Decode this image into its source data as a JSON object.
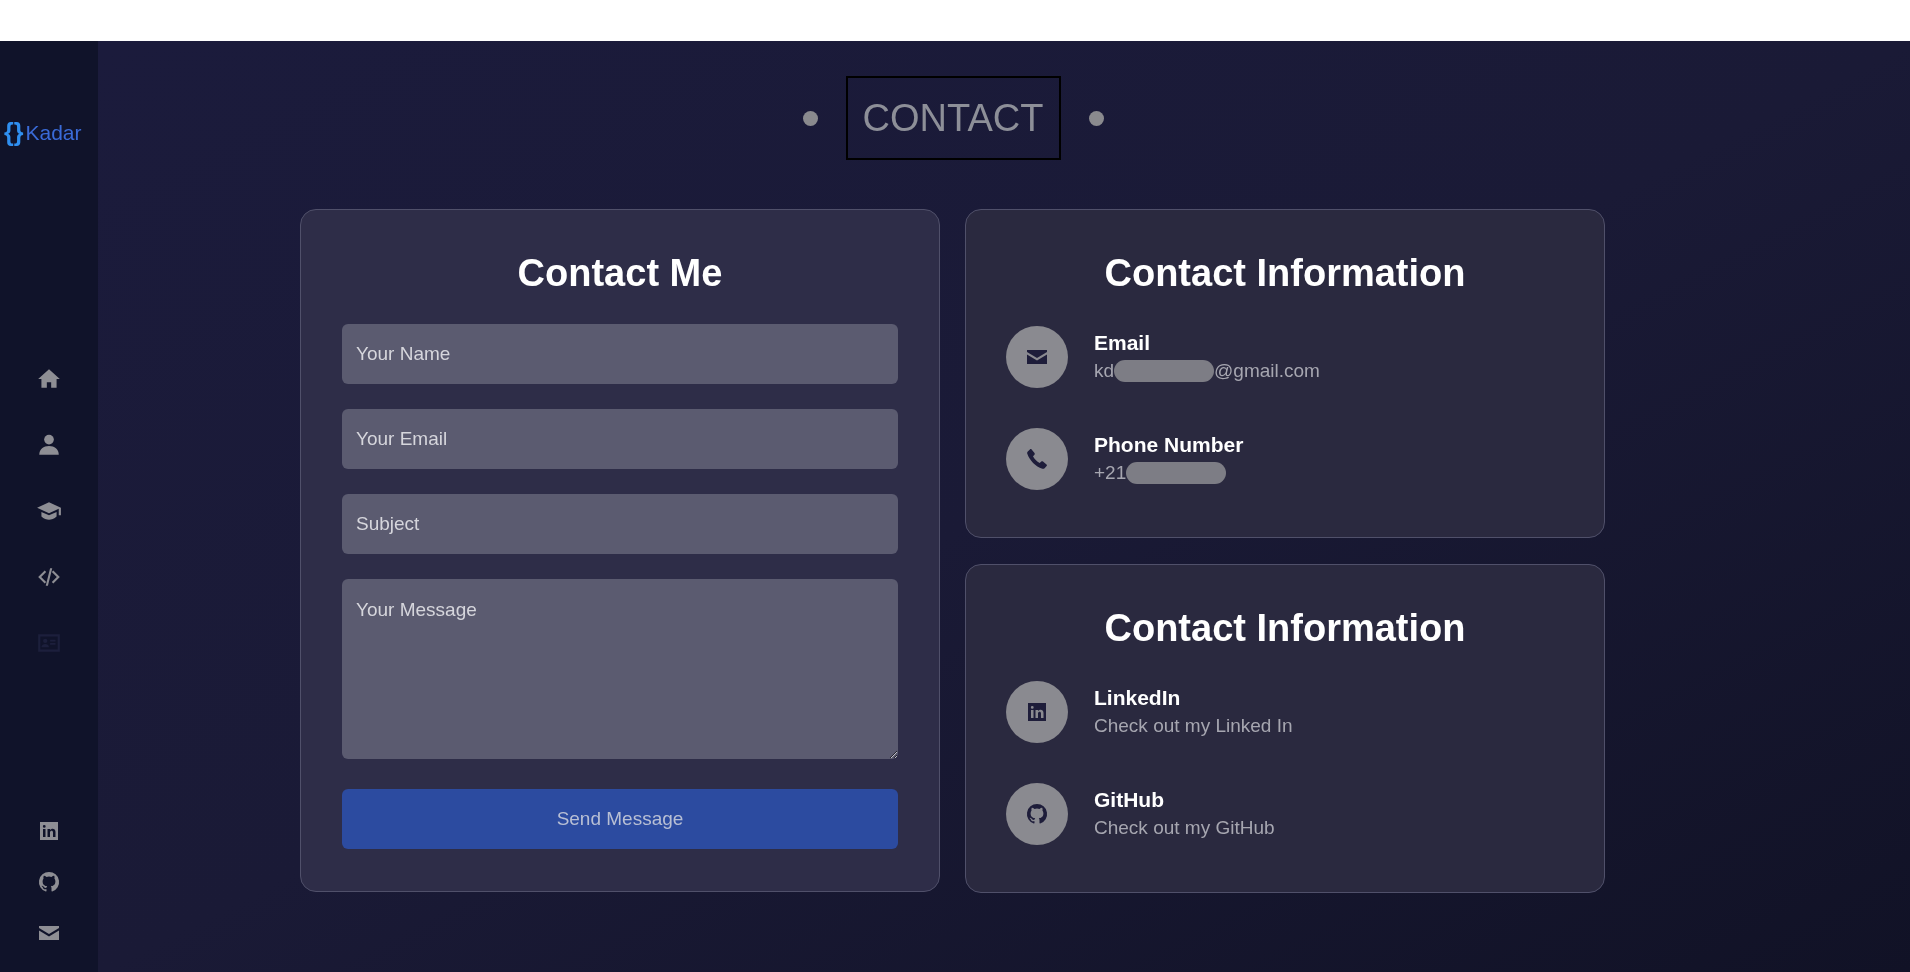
{
  "sidebar": {
    "logo": {
      "brace": "{}",
      "name": "Kadar"
    },
    "nav_items": [
      {
        "kind": "home",
        "selected": false
      },
      {
        "kind": "user",
        "selected": false
      },
      {
        "kind": "education",
        "selected": false
      },
      {
        "kind": "code",
        "selected": false
      },
      {
        "kind": "contact",
        "selected": true
      }
    ],
    "social_links": [
      {
        "kind": "linkedin"
      },
      {
        "kind": "github"
      },
      {
        "kind": "email"
      }
    ]
  },
  "section_title": "CONTACT",
  "form": {
    "title": "Contact Me",
    "fields": [
      {
        "kind": "input",
        "placeholder": "Your Name"
      },
      {
        "kind": "input",
        "placeholder": "Your Email"
      },
      {
        "kind": "input",
        "placeholder": "Subject"
      },
      {
        "kind": "textarea",
        "placeholder": "Your Message"
      }
    ],
    "submit": "Send Message"
  },
  "info_cards": [
    {
      "title": "Contact Information",
      "items": [
        {
          "kind": "email",
          "label": "Email",
          "value_start": "kd",
          "value_end": "@gmail.com",
          "redacted": true
        },
        {
          "kind": "phone",
          "label": "Phone Number",
          "value_start": "+21",
          "redacted": true
        }
      ]
    },
    {
      "title": "Contact Information",
      "items": [
        {
          "kind": "linkedin",
          "label": "LinkedIn",
          "value_start": "Check out my Linked In",
          "redacted": false
        },
        {
          "kind": "github",
          "label": "GitHub",
          "value_start": "Check out my GitHub",
          "redacted": false
        }
      ]
    }
  ]
}
